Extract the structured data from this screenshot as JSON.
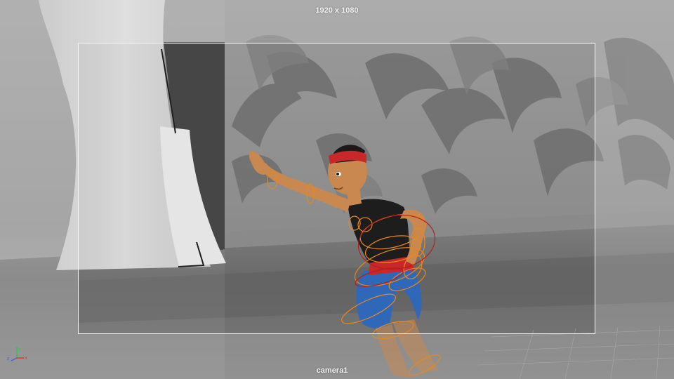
{
  "viewport": {
    "resolution_label": "1920 x 1080",
    "camera_name": "camera1"
  },
  "axis_gizmo": {
    "x_label": "x",
    "y_label": "y",
    "z_label": "z",
    "x_color": "#d83a2a",
    "y_color": "#34c24a",
    "z_color": "#3a66e0"
  },
  "colors": {
    "control_curve_orange": "#e8871e",
    "control_curve_red": "#b3201a",
    "headband": "#c8282a",
    "shirt": "#1d1d1d",
    "pants": "#2f68b8",
    "skin": "#c98850"
  }
}
